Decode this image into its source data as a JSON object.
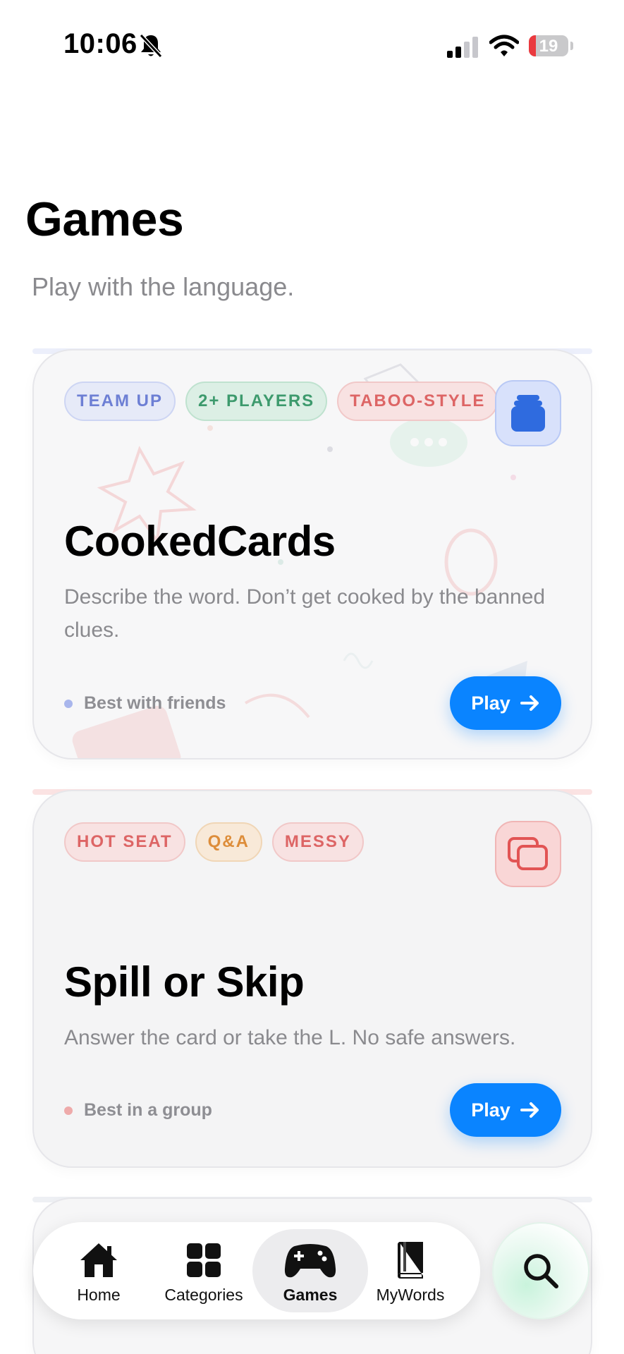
{
  "status_bar": {
    "time": "10:06",
    "battery_level": "19",
    "icons": [
      "bell-slash-icon",
      "cellular-signal-icon",
      "wifi-icon",
      "battery-icon"
    ]
  },
  "header": {
    "title": "Games",
    "subtitle": "Play with the language."
  },
  "games": [
    {
      "tags": [
        "TEAM UP",
        "2+ PLAYERS",
        "TABOO-STYLE"
      ],
      "icon": "card-stack-icon",
      "title": "CookedCards",
      "description": "Describe the word. Don’t get cooked by the banned clues.",
      "best_with": "Best with friends",
      "play_label": "Play",
      "accent": "#6d7fd4"
    },
    {
      "tags": [
        "HOT SEAT",
        "Q&A",
        "MESSY"
      ],
      "icon": "overlapping-cards-icon",
      "title": "Spill or Skip",
      "description": "Answer the card or take the L. No safe answers.",
      "best_with": "Best in a group",
      "play_label": "Play",
      "accent": "#dd6565"
    }
  ],
  "tab_bar": {
    "items": [
      {
        "label": "Home",
        "icon": "house-icon",
        "active": false
      },
      {
        "label": "Categories",
        "icon": "grid-icon",
        "active": false
      },
      {
        "label": "Games",
        "icon": "gamepad-icon",
        "active": true
      },
      {
        "label": "MyWords",
        "icon": "book-icon",
        "active": false
      }
    ],
    "search_icon": "magnifier-icon"
  },
  "colors": {
    "primary": "#0a84ff",
    "text_secondary": "#8a8a8e",
    "card_background": "#f7f7f8"
  }
}
